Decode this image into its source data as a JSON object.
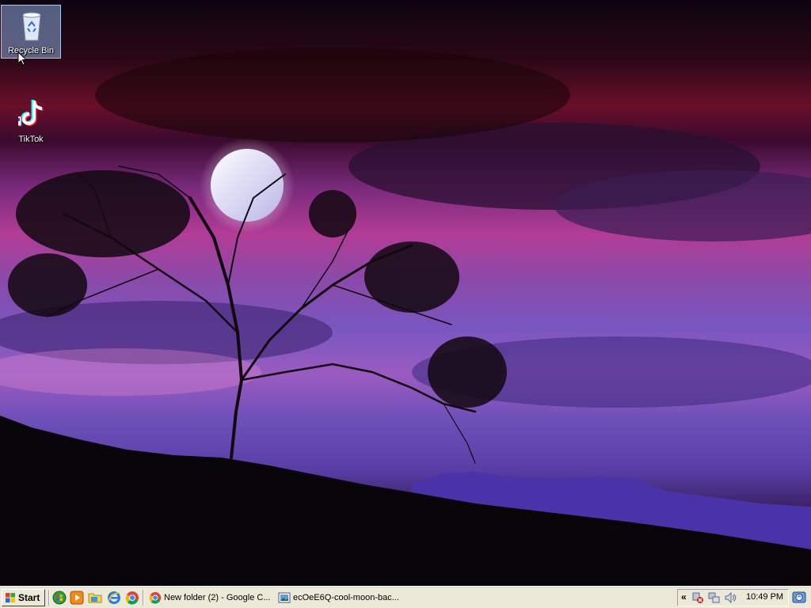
{
  "desktop": {
    "icons": [
      {
        "label": "Recycle Bin",
        "icon": "recycle-bin-icon"
      },
      {
        "label": "TikTok",
        "icon": "tiktok-icon"
      }
    ]
  },
  "taskbar": {
    "start_label": "Start",
    "quick_launch": [
      "windows-update-icon",
      "media-player-icon",
      "folder-icon",
      "internet-explorer-icon",
      "chrome-icon"
    ],
    "tasks": [
      {
        "label": "New folder (2) - Google C...",
        "icon": "chrome-icon"
      },
      {
        "label": "ecOeE6Q-cool-moon-bac...",
        "icon": "image-viewer-icon"
      }
    ],
    "tray": {
      "expand_label": "«",
      "icons": [
        "network-error-icon",
        "network-icon",
        "volume-icon"
      ],
      "clock": "10:49 PM"
    }
  }
}
